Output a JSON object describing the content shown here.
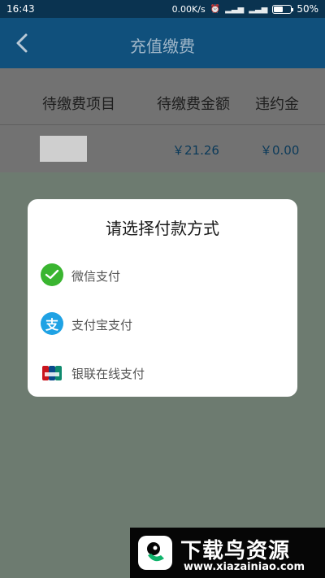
{
  "status_bar": {
    "time": "16:43",
    "speed": "0.00K/s",
    "battery_percent": 50,
    "battery_label": "50%"
  },
  "app_bar": {
    "title": "充值缴费",
    "back_icon": "back-arrow-icon"
  },
  "table": {
    "headers": [
      "待缴费项目",
      "待缴费金额",
      "违约金"
    ],
    "rows": [
      {
        "item": "",
        "amount": "￥21.26",
        "penalty": "￥0.00"
      }
    ]
  },
  "payment_dialog": {
    "title": "请选择付款方式",
    "options": [
      {
        "label": "微信支付",
        "icon": "wechat-pay-icon",
        "color": "#3ab530"
      },
      {
        "label": "支付宝支付",
        "icon": "alipay-icon",
        "color": "#1fa2e4"
      },
      {
        "label": "银联在线支付",
        "icon": "unionpay-icon",
        "color": "#c9151e"
      }
    ]
  },
  "watermark": {
    "title": "下载鸟资源",
    "url": "www.xiazainiao.com"
  },
  "colors": {
    "status_bar": "#0a3350",
    "app_bar": "#10507c",
    "overlay": "#6d7b70",
    "amount_text": "#0b3a5a"
  }
}
